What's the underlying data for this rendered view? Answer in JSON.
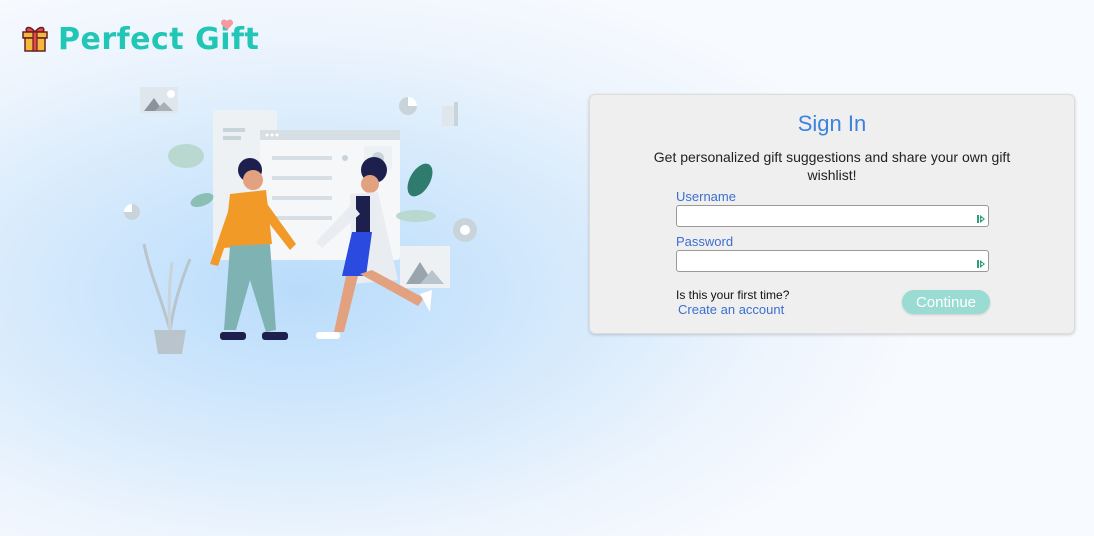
{
  "brand": {
    "name": "Perfect Gift",
    "icon": "gift-icon",
    "color": "#22c6b7",
    "heart_color": "#f29aa0"
  },
  "signin": {
    "title": "Sign In",
    "subtitle": "Get personalized gift suggestions and share your own gift wishlist!",
    "username": {
      "label": "Username",
      "value": "",
      "placeholder": ""
    },
    "password": {
      "label": "Password",
      "value": "",
      "placeholder": ""
    },
    "first_time_text": "Is this your first time?",
    "create_account_link": "Create an account",
    "continue_button": "Continue"
  },
  "colors": {
    "accent": "#3b82e0",
    "button": "#9adcd3",
    "card": "#efefef"
  }
}
